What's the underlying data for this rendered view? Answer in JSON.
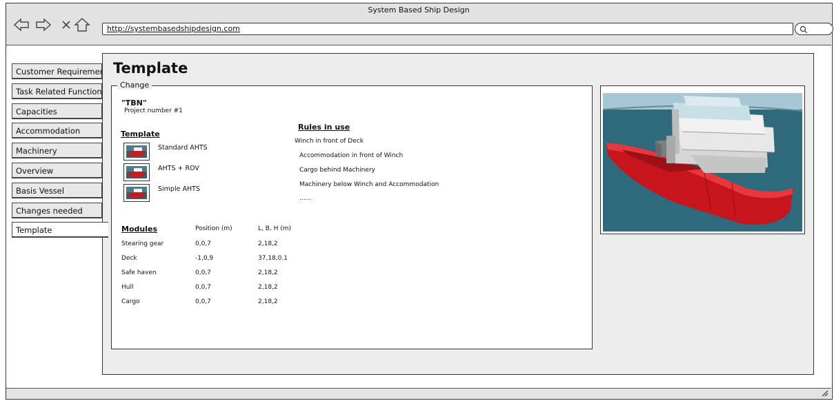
{
  "window": {
    "title": "System Based Ship Design"
  },
  "browser": {
    "url": "http://systembasedshipdesign.com",
    "nav_icons": [
      "back-icon",
      "forward-icon",
      "close-icon",
      "home-icon",
      "search-icon"
    ]
  },
  "sidebar": {
    "items": [
      {
        "label": "Customer Requirements",
        "active": false
      },
      {
        "label": "Task Related Functions",
        "active": false
      },
      {
        "label": "Capacities",
        "active": false
      },
      {
        "label": "Accommodation",
        "active": false
      },
      {
        "label": "Machinery",
        "active": false
      },
      {
        "label": "Overview",
        "active": false
      },
      {
        "label": "Basis Vessel",
        "active": false
      },
      {
        "label": "Changes needed",
        "active": false
      },
      {
        "label": "Template",
        "active": true
      }
    ]
  },
  "main": {
    "title": "Template",
    "change_legend": "Change",
    "project_name": "\"TBN\"",
    "project_number": "Project number #1",
    "template_heading": "Template",
    "templates": [
      "Standard AHTS",
      "AHTS + ROV",
      "Simple AHTS"
    ],
    "rules_heading": "Rules in use",
    "rules": [
      "Winch in front of Deck",
      "Accommodation in front of Winch",
      "Cargo behind Machinery",
      "Machinery below Winch and Accommodation",
      "......"
    ],
    "modules_heading": "Modules",
    "position_header": "Position (m)",
    "dims_header": "L, B, H (m)",
    "modules": [
      {
        "name": "Stearing gear",
        "position": "0,0,7",
        "dims": "2,18,2"
      },
      {
        "name": "Deck",
        "position": "-1,0,9",
        "dims": "37,18,0.1"
      },
      {
        "name": "Safe haven",
        "position": "0,0,7",
        "dims": "2,18,2"
      },
      {
        "name": "Hull",
        "position": "0,0,7",
        "dims": "2,18,2"
      },
      {
        "name": "Cargo",
        "position": "0,0,7",
        "dims": "2,18,2"
      }
    ]
  },
  "colors": {
    "hull_red": "#c8141c",
    "sea": "#2e6a7c",
    "sky": "#a8c7d4",
    "chrome": "#e2e2e2"
  }
}
